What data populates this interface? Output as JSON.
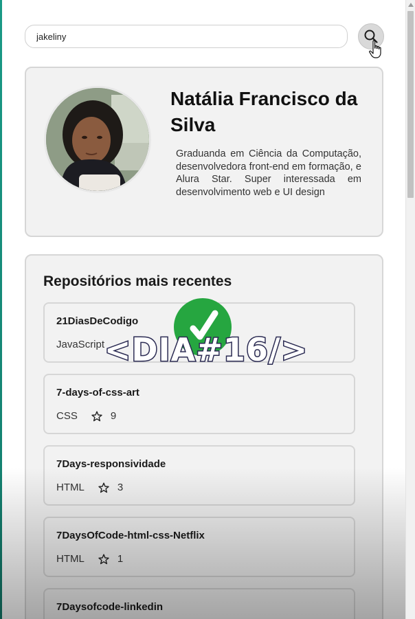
{
  "search": {
    "value": "jakeliny",
    "button_icon": "search-icon"
  },
  "profile": {
    "name": "Natália Francisco da Silva",
    "bio": "Graduanda em Ciência da Computação, desenvolvedora front-end em formação, e Alura Star. Super interessada em desenvolvimento web e UI design",
    "avatar_icon": "avatar-photo"
  },
  "repositories": {
    "title": "Repositórios mais recentes",
    "items": [
      {
        "name": "21DiasDeCodigo",
        "language": "JavaScript",
        "stars": ""
      },
      {
        "name": "7-days-of-css-art",
        "language": "CSS",
        "stars": "9"
      },
      {
        "name": "7Days-responsividade",
        "language": "HTML",
        "stars": "3"
      },
      {
        "name": "7DaysOfCode-html-css-Netflix",
        "language": "HTML",
        "stars": "1"
      },
      {
        "name": "7Daysofcode-linkedin",
        "language": "",
        "stars": ""
      }
    ]
  },
  "overlay": {
    "badge_text": "<DIA#16/>",
    "check_color": "#26a640"
  },
  "colors": {
    "card_background": "#f2f2f2",
    "card_border": "#d6d6d6",
    "accent": "#1a9a86"
  }
}
